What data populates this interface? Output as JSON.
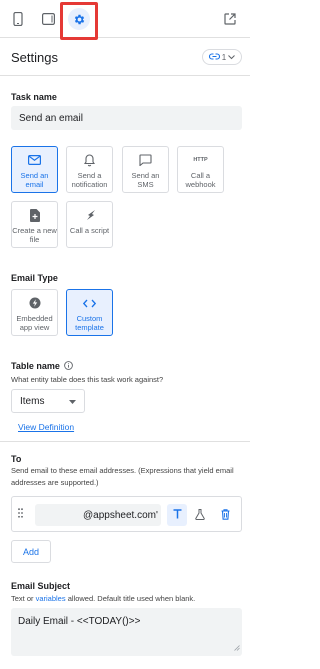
{
  "toolbar": {
    "icons": [
      "phone-icon",
      "tablet-icon",
      "gear-icon",
      "open-external-icon"
    ]
  },
  "header": {
    "title": "Settings",
    "version_label": "1"
  },
  "task_name": {
    "label": "Task name",
    "value": "Send an email"
  },
  "task_types": [
    {
      "label": "Send an email",
      "icon": "email-icon",
      "selected": true
    },
    {
      "label": "Send a notification",
      "icon": "bell-icon",
      "selected": false
    },
    {
      "label": "Send an SMS",
      "icon": "sms-icon",
      "selected": false
    },
    {
      "label": "Call a webhook",
      "icon": "http-icon",
      "icon_text": "HTTP",
      "selected": false
    },
    {
      "label": "Create a new file",
      "icon": "new-file-icon",
      "selected": false
    },
    {
      "label": "Call a script",
      "icon": "script-icon",
      "selected": false
    }
  ],
  "email_type": {
    "label": "Email Type",
    "options": [
      {
        "label": "Embedded app view",
        "icon": "lightning-icon",
        "selected": false
      },
      {
        "label": "Custom template",
        "icon": "code-icon",
        "selected": true
      }
    ]
  },
  "table_name": {
    "label": "Table name",
    "help": "What entity table does this task work against?",
    "selected": "Items",
    "view_link": "View Definition"
  },
  "to": {
    "label": "To",
    "help": "Send email to these email addresses. (Expressions that yield email addresses are supported.)",
    "email_value": "@appsheet.com'",
    "add_label": "Add"
  },
  "subject": {
    "label": "Email Subject",
    "help_before": "Text or ",
    "help_link": "variables",
    "help_after": " allowed. Default title used when blank.",
    "value": "Daily Email - <<TODAY()>>"
  },
  "colors": {
    "accent": "#1a73e8",
    "selected_bg": "#e8f0fe",
    "highlight": "#e53935",
    "field_bg": "#f1f3f4"
  }
}
